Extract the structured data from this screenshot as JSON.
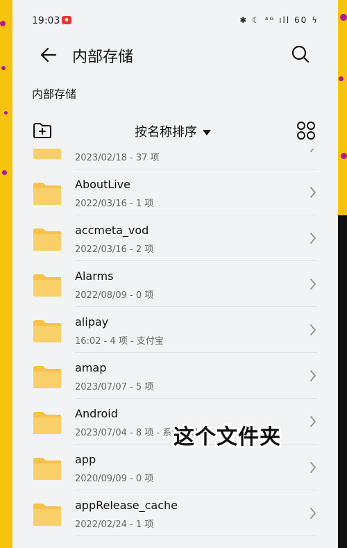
{
  "status_bar": {
    "time": "19:03",
    "icons": "✱ ☾ ⁴ᴳ ıll 60 ϟ"
  },
  "header": {
    "title": "内部存储"
  },
  "breadcrumb": "内部存储",
  "toolbar": {
    "sort_label": "按名称排序"
  },
  "files": [
    {
      "name": "",
      "meta": "2023/02/18 - 37 项"
    },
    {
      "name": "AboutLive",
      "meta": "2022/03/16 - 1 项"
    },
    {
      "name": "accmeta_vod",
      "meta": "2022/03/16 - 2 项"
    },
    {
      "name": "Alarms",
      "meta": "2022/08/09 - 0 项"
    },
    {
      "name": "alipay",
      "meta": "16:02 - 4 项 - 支付宝"
    },
    {
      "name": "amap",
      "meta": "2023/07/07 - 5 项"
    },
    {
      "name": "Android",
      "meta": "2023/07/04 - 8 项 - 系统目录"
    },
    {
      "name": "app",
      "meta": "2020/09/09 - 0 项"
    },
    {
      "name": "appRelease_cache",
      "meta": "2022/02/24 - 1 项"
    }
  ],
  "overlay_caption": "这个文件夹",
  "colors": {
    "background": "#f6c40f",
    "folder": "#f7c14a",
    "accent_dots": "#b5188e"
  }
}
